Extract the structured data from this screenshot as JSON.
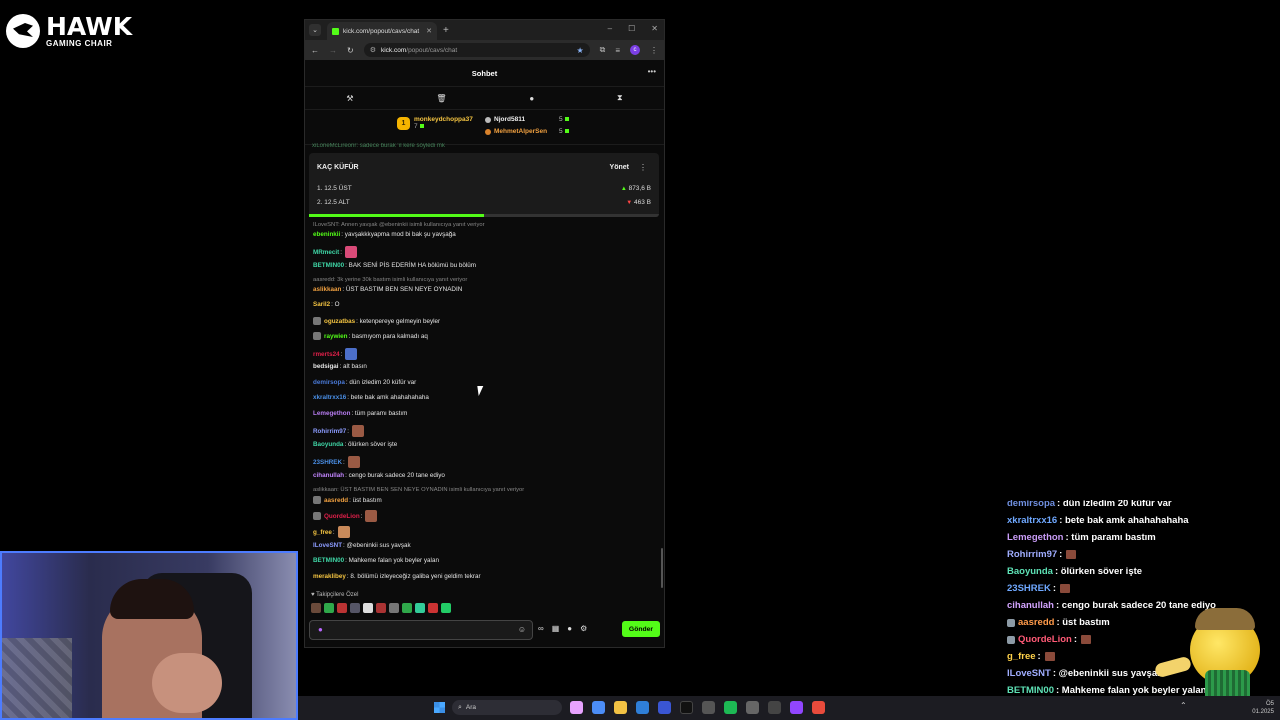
{
  "logo": {
    "title": "HAWK",
    "subtitle": "GAMING CHAIR"
  },
  "browser": {
    "tab_title": "kick.com/popout/cavs/chat",
    "url_host": "kick.com",
    "url_path": "/popout/cavs/chat",
    "profile_initial": "c"
  },
  "chat": {
    "title": "Sohbet",
    "leaderboard": {
      "first": {
        "rank": "1",
        "name": "monkeydchoppa37",
        "points": "7"
      },
      "second": {
        "name": "Njord5811",
        "points": "5"
      },
      "third": {
        "name": "MehmetAlperSen",
        "points": "5"
      }
    },
    "pinned_peek": "xiLoneMcLireonr: sadece burak 'ıl kere söyledi mk",
    "poll": {
      "title": "KAÇ KÜFÜR",
      "manage_label": "Yönet",
      "options": [
        {
          "label": "1. 12.5 ÜST",
          "amount": "873,6 B"
        },
        {
          "label": "2. 12.5 ALT",
          "amount": "463 B"
        }
      ],
      "progress": 0.5
    },
    "messages": [
      {
        "reply": "ILoveSNT: Annen yavşak @ebeninkii isimli kullanıcıya yanıt veriyor"
      },
      {
        "user": "ebeninkii",
        "color": "#53fc18",
        "text": ": yavşakkkyapma mod bi bak şu yavşağa"
      },
      {
        "user": "MRmecit",
        "color": "#3fd6a6",
        "text": ":",
        "emote": "#d94a78"
      },
      {
        "user": "BETMIN00",
        "color": "#3fd6a6",
        "text": ": BAK SENİ PİS EDERİM HA bölümü bu bölüm"
      },
      {
        "reply": "aasredd: 3k yerine 30k bastım isimli kullanıcıya yanıt veriyor"
      },
      {
        "user": "aslikkaan",
        "color": "#f0a040",
        "text": ": ÜST BASTIM BEN SEN NEYE OYNADIN"
      },
      {
        "user": "Saril2",
        "color": "#f5c542",
        "text": ": O"
      },
      {
        "user": "oguzatbas",
        "color": "#f5c542",
        "text": ": ketenpereye gelmeyin beyler",
        "badge": true
      },
      {
        "user": "raywien",
        "color": "#53fc18",
        "text": ": basmıyom para kalmadı aq",
        "badge": true
      },
      {
        "user": "rmerts24",
        "color": "#e0204a",
        "text": ":",
        "emote": "#4c6fc9"
      },
      {
        "user": "bedsigai",
        "color": "#e8e8e8",
        "text": ": alt basın"
      },
      {
        "user": "demirsopa",
        "color": "#4a7ad8",
        "text": ": dün izledim 20 küfür var"
      },
      {
        "user": "xkraltrxx16",
        "color": "#4a8fe6",
        "text": ": bete bak amk ahahahahaha"
      },
      {
        "user": "Lemegethon",
        "color": "#b77cf0",
        "text": ": tüm paramı bastım"
      },
      {
        "user": "Rohirrim97",
        "color": "#8c9cff",
        "text": ":",
        "emote": "#9a5a44"
      },
      {
        "user": "Baoyunda",
        "color": "#3fd6a6",
        "text": ": ölürken söver işte"
      },
      {
        "user": "23SHREK",
        "color": "#4a8fe6",
        "text": ":",
        "emote": "#9a5a44"
      },
      {
        "user": "cihanullah",
        "color": "#c084fc",
        "text": ": cengo burak sadece 20 tane ediyo"
      },
      {
        "reply": "aslikkaan: ÜST BASTIM BEN SEN NEYE OYNADIN isimli kullanıcıya yanıt veriyor"
      },
      {
        "user": "aasredd",
        "color": "#f0a040",
        "text": ": üst bastım",
        "badge": true
      },
      {
        "user": "QuordeLion",
        "color": "#e0204a",
        "text": ":",
        "emote": "#9a5a44",
        "badge": true
      },
      {
        "user": "g_free",
        "color": "#f5c542",
        "text": ":",
        "emote": "#c98a5a"
      },
      {
        "user": "ILoveSNT",
        "color": "#8c9cff",
        "text": ": @ebeninkii sus yavşak"
      },
      {
        "user": "BETMIN00",
        "color": "#3fd6a6",
        "text": ": Mahkeme falan yok beyler yalan"
      },
      {
        "user": "meraklibey",
        "color": "#f5c542",
        "text": ": 8. bölümü izleyeceğiz galiba yeni geldim tekrar"
      }
    ],
    "follower_note": "Takipçilere Özel",
    "send_label": "Gönder"
  },
  "overlay": {
    "lines": [
      {
        "user": "demirsopa",
        "color": "#6f8fe0",
        "text": ": dün izledim 20 küfür var"
      },
      {
        "user": "xkraltrxx16",
        "color": "#6fa8ff",
        "text": ": bete bak amk ahahahahaha"
      },
      {
        "user": "Lemegethon",
        "color": "#c99cf7",
        "text": ": tüm paramı bastım"
      },
      {
        "user": "Rohirrim97",
        "color": "#a0adff",
        "text": ":",
        "emote": true
      },
      {
        "user": "Baoyunda",
        "color": "#5ee2b6",
        "text": ": ölürken söver işte"
      },
      {
        "user": "23SHREK",
        "color": "#6fa8ff",
        "text": ":",
        "emote": true
      },
      {
        "user": "cihanullah",
        "color": "#d3a4ff",
        "text": ": cengo burak sadece 20 tane ediyo"
      },
      {
        "user": "aasredd",
        "color": "#ff9a4a",
        "text": ": üst bastım",
        "badge": true
      },
      {
        "user": "QuordeLion",
        "color": "#ff5a76",
        "text": ":",
        "emote": true,
        "badge": true
      },
      {
        "user": "g_free",
        "color": "#ffd24a",
        "text": ":",
        "emote": true
      },
      {
        "user": "ILoveSNT",
        "color": "#a0adff",
        "text": ": @ebeninkii sus yavşak"
      },
      {
        "user": "BETMIN00",
        "color": "#5ee2b6",
        "text": ": Mahkeme falan yok beyler yalan"
      },
      {
        "user": "",
        "color": "#fff",
        "text": "izleyeceğiz galiba yeni geldim tekrar"
      }
    ]
  },
  "taskbar": {
    "search_label": "Ara",
    "tray_time": "Ö5",
    "tray_date": "01.2025"
  }
}
